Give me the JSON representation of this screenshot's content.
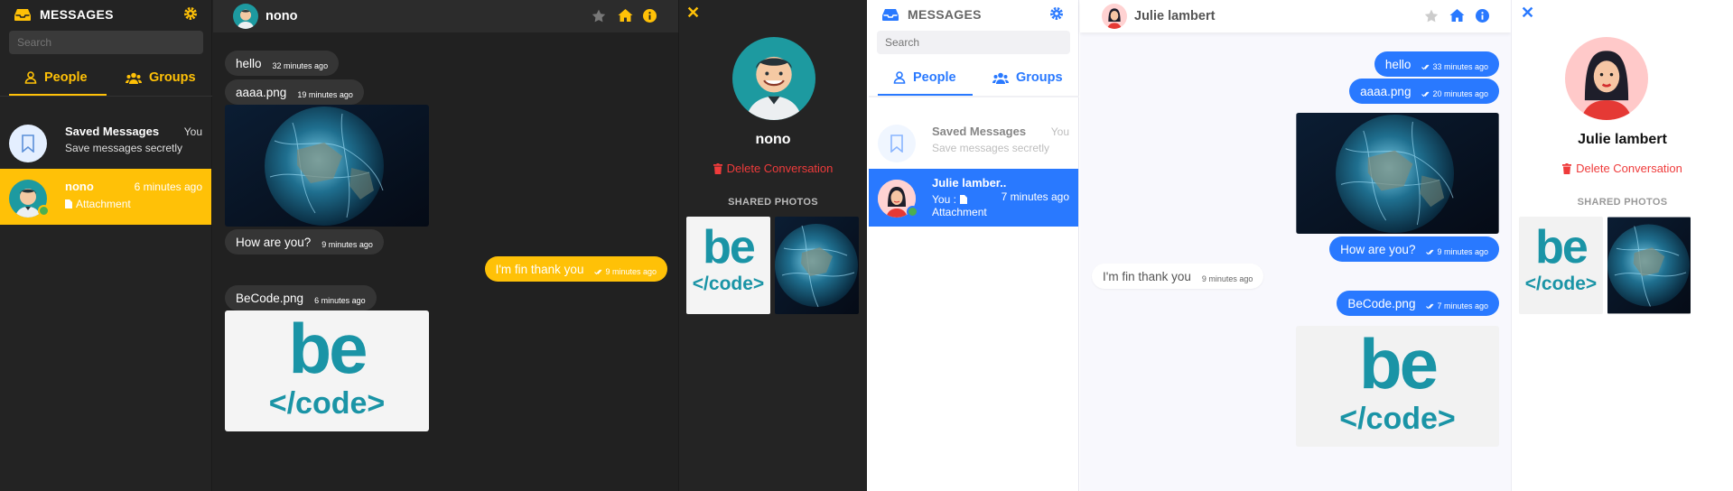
{
  "dark": {
    "sidebar": {
      "title": "MESSAGES",
      "search_placeholder": "Search",
      "tabs": [
        {
          "label": "People"
        },
        {
          "label": "Groups"
        }
      ],
      "conversations": [
        {
          "name": "Saved Messages",
          "subtitle": "Save messages secretly",
          "time": "You"
        },
        {
          "name": "nono",
          "subtitle": "Attachment",
          "time": "6 minutes ago"
        }
      ]
    },
    "chat": {
      "contact_name": "nono",
      "messages": [
        {
          "text": "hello",
          "time": "32 minutes ago"
        },
        {
          "text": "aaaa.png",
          "time": "19 minutes ago"
        },
        {
          "text": "How are you?",
          "time": "9 minutes ago"
        },
        {
          "text": "I'm fin thank you",
          "time": "9 minutes ago"
        },
        {
          "text": "BeCode.png",
          "time": "6 minutes ago"
        }
      ]
    },
    "info": {
      "name": "nono",
      "delete_label": "Delete Conversation",
      "shared_photos_label": "SHARED PHOTOS"
    }
  },
  "light": {
    "sidebar": {
      "title": "MESSAGES",
      "search_placeholder": "Search",
      "tabs": [
        {
          "label": "People"
        },
        {
          "label": "Groups"
        }
      ],
      "conversations": [
        {
          "name": "Saved Messages",
          "subtitle": "Save messages secretly",
          "time": "You"
        },
        {
          "name": "Julie lamber..",
          "subtitle_prefix": "You :",
          "subtitle": "Attachment",
          "time": "7 minutes ago"
        }
      ]
    },
    "chat": {
      "contact_name": "Julie lambert",
      "messages": [
        {
          "text": "hello",
          "time": "33 minutes ago"
        },
        {
          "text": "aaaa.png",
          "time": "20 minutes ago"
        },
        {
          "text": "How are you?",
          "time": "9 minutes ago"
        },
        {
          "text": "I'm fin thank you",
          "time": "9 minutes ago"
        },
        {
          "text": "BeCode.png",
          "time": "7 minutes ago"
        }
      ]
    },
    "info": {
      "name": "Julie lambert",
      "delete_label": "Delete Conversation",
      "shared_photos_label": "SHARED PHOTOS"
    }
  },
  "becode_logo": {
    "line1": "be",
    "line2": "</code>"
  },
  "colors": {
    "dark_accent": "#ffc107",
    "light_accent": "#2979ff",
    "delete_red": "#ef3b3b",
    "online_green": "#4caf50",
    "logo_teal": "#1a94a6"
  },
  "icons": [
    "inbox-icon",
    "gear-icon",
    "user-icon",
    "users-icon",
    "bookmark-icon",
    "file-icon",
    "star-icon",
    "home-icon",
    "info-icon",
    "close-icon",
    "trash-icon",
    "double-check-icon"
  ]
}
